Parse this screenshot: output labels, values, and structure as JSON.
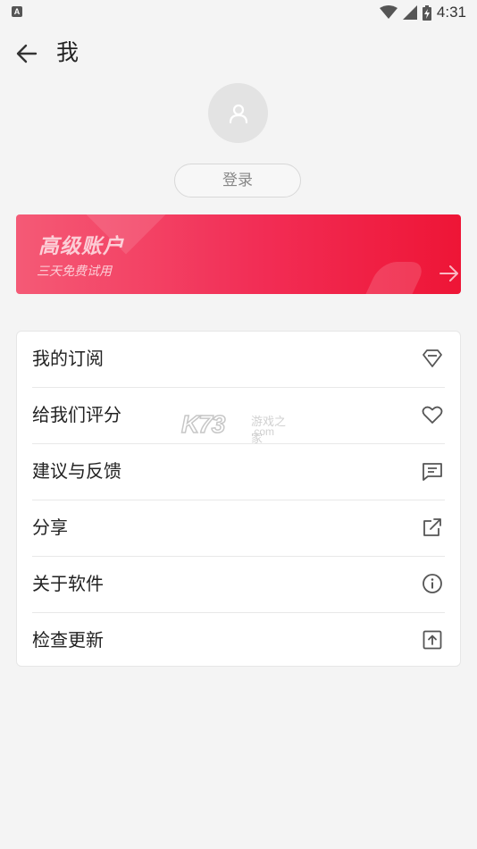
{
  "status_bar": {
    "time": "4:31",
    "notification_icon": "A",
    "icons": [
      "wifi-icon",
      "signal-icon",
      "battery-icon"
    ]
  },
  "header": {
    "title": "我",
    "back_icon": "arrow-left-icon"
  },
  "profile": {
    "avatar_icon": "user-icon",
    "login_label": "登录"
  },
  "premium": {
    "title": "高级账户",
    "subtitle": "三天免费试用",
    "arrow_icon": "arrow-right-icon",
    "gradient_start": "#f45a76",
    "gradient_end": "#ee1536"
  },
  "menu": {
    "items": [
      {
        "label": "我的订阅",
        "icon": "diamond-icon"
      },
      {
        "label": "给我们评分",
        "icon": "heart-icon"
      },
      {
        "label": "建议与反馈",
        "icon": "feedback-icon"
      },
      {
        "label": "分享",
        "icon": "share-icon"
      },
      {
        "label": "关于软件",
        "icon": "info-icon"
      },
      {
        "label": "检查更新",
        "icon": "upload-icon"
      }
    ]
  },
  "watermark": {
    "brand": "K73",
    "text": "游戏之家",
    "domain": ".com"
  },
  "colors": {
    "background": "#f4f4f4",
    "card": "#ffffff",
    "text": "#222222",
    "icon": "#555555"
  }
}
